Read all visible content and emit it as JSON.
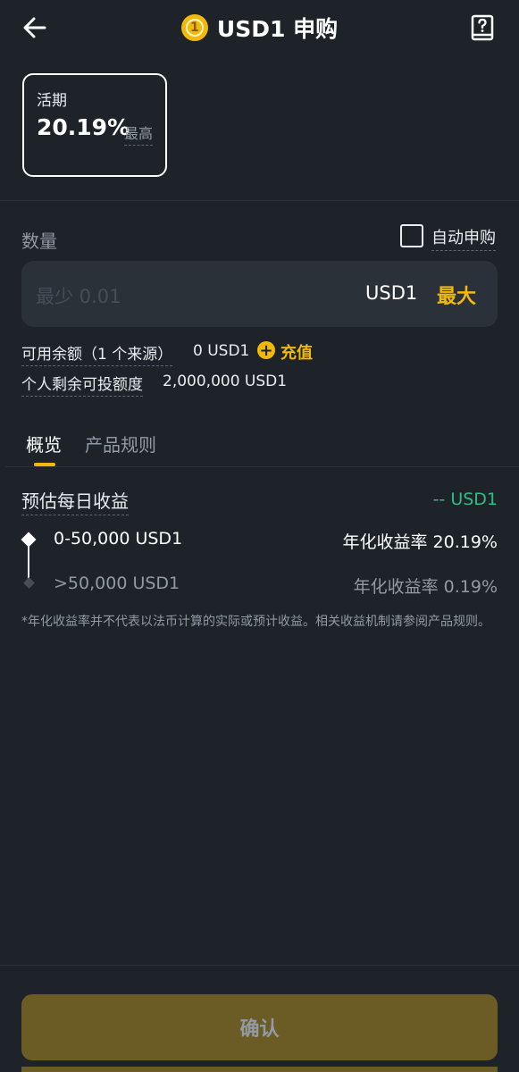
{
  "header": {
    "title": "USD1 申购",
    "coin_glyph": "1",
    "back_icon": "arrow-left-icon",
    "help_icon": "question-book-icon"
  },
  "term_card": {
    "label": "活期",
    "rate": "20.19%",
    "rate_suffix": "最高"
  },
  "amount": {
    "label": "数量",
    "auto_subscribe_label": "自动申购",
    "auto_subscribe_checked": false,
    "placeholder": "最少 0.01",
    "unit": "USD1",
    "max_label": "最大"
  },
  "balance": {
    "available_label": "可用余额（1 个来源）",
    "available_value": "0 USD1",
    "deposit_label": "充值",
    "quota_label": "个人剩余可投额度",
    "quota_value": "2,000,000 USD1"
  },
  "tabs": [
    {
      "label": "概览",
      "active": true
    },
    {
      "label": "产品规则",
      "active": false
    }
  ],
  "overview": {
    "est_label": "预估每日收益",
    "est_value": "-- USD1",
    "tiers": [
      {
        "range": "0-50,000 USD1",
        "rate": "年化收益率 20.19%"
      },
      {
        "range": ">50,000 USD1",
        "rate": "年化收益率 0.19%"
      }
    ],
    "disclaimer": "*年化收益率并不代表以法币计算的实际或预计收益。相关收益机制请参阅产品规则。"
  },
  "confirm_label": "确认",
  "colors": {
    "background": "#1e2329",
    "accent": "#f0b90b",
    "positive": "#2ebd85",
    "button_disabled": "#6b5c25"
  }
}
